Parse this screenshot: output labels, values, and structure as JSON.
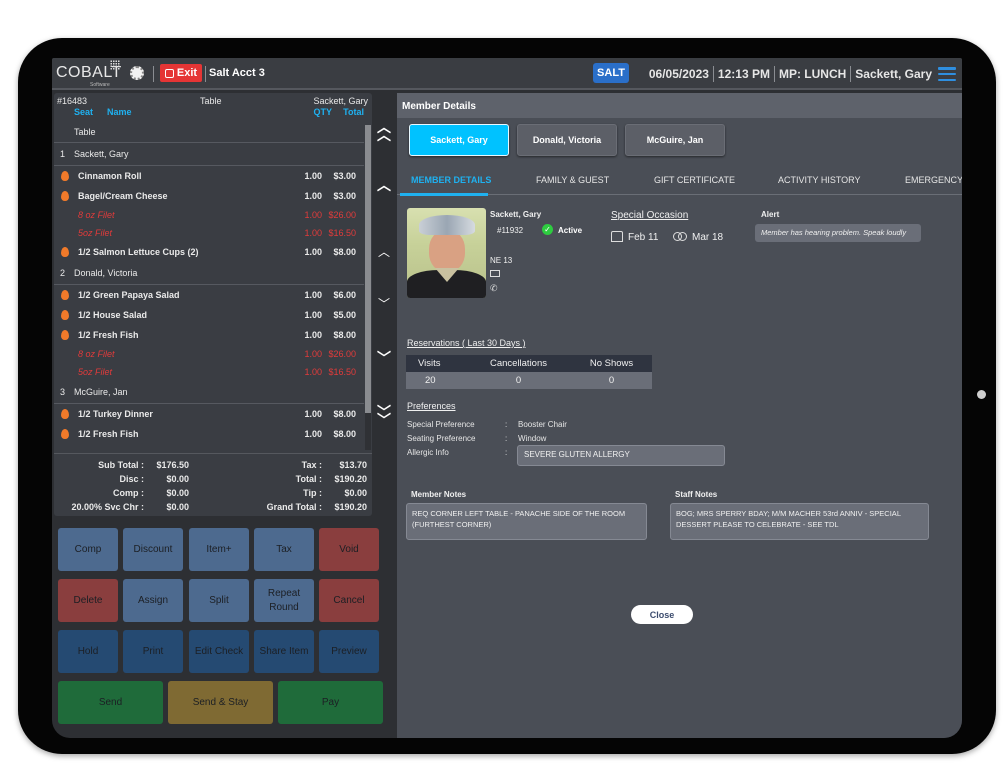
{
  "topbar": {
    "logo": "COBALT",
    "logo_sub": "Software",
    "exit_label": "Exit",
    "account": "Salt Acct 3",
    "location_badge": "SALT",
    "date": "06/05/2023",
    "time": "12:13 PM",
    "meal_period": "MP: LUNCH",
    "user": "Sackett, Gary"
  },
  "order": {
    "check_number": "#16483",
    "table_label": "Table",
    "server": "Sackett, Gary",
    "columns": {
      "seat": "Seat",
      "name": "Name",
      "qty": "QTY",
      "total": "Total"
    },
    "table_row": "Table",
    "seats": [
      {
        "number": "1",
        "name": "Sackett, Gary",
        "items": [
          {
            "name": "Cinnamon Roll",
            "qty": "1.00",
            "total": "$3.00",
            "type": "item"
          },
          {
            "name": "Bagel/Cream Cheese",
            "qty": "1.00",
            "total": "$3.00",
            "type": "item"
          },
          {
            "name": "8 oz Filet",
            "qty": "1.00",
            "total": "$26.00",
            "type": "mod"
          },
          {
            "name": "5oz Filet",
            "qty": "1.00",
            "total": "$16.50",
            "type": "mod"
          },
          {
            "name": "1/2 Salmon Lettuce Cups (2)",
            "qty": "1.00",
            "total": "$8.00",
            "type": "item"
          }
        ]
      },
      {
        "number": "2",
        "name": "Donald, Victoria",
        "items": [
          {
            "name": "1/2 Green Papaya Salad",
            "qty": "1.00",
            "total": "$6.00",
            "type": "item"
          },
          {
            "name": "1/2 House Salad",
            "qty": "1.00",
            "total": "$5.00",
            "type": "item"
          },
          {
            "name": "1/2 Fresh Fish",
            "qty": "1.00",
            "total": "$8.00",
            "type": "item"
          },
          {
            "name": "8 oz Filet",
            "qty": "1.00",
            "total": "$26.00",
            "type": "mod"
          },
          {
            "name": "5oz Filet",
            "qty": "1.00",
            "total": "$16.50",
            "type": "mod"
          }
        ]
      },
      {
        "number": "3",
        "name": "McGuire, Jan",
        "items": [
          {
            "name": "1/2 Turkey Dinner",
            "qty": "1.00",
            "total": "$8.00",
            "type": "item"
          },
          {
            "name": "1/2 Fresh Fish",
            "qty": "1.00",
            "total": "$8.00",
            "type": "item"
          }
        ]
      }
    ],
    "totals": {
      "subtotal_label": "Sub Total :",
      "subtotal": "$176.50",
      "disc_label": "Disc :",
      "disc": "$0.00",
      "comp_label": "Comp :",
      "comp": "$0.00",
      "svc_label": "20.00% Svc Chr :",
      "svc": "$0.00",
      "tax_label": "Tax :",
      "tax": "$13.70",
      "total_label": "Total :",
      "total": "$190.20",
      "tip_label": "Tip :",
      "tip": "$0.00",
      "grand_label": "Grand Total :",
      "grand": "$190.20"
    }
  },
  "actions": {
    "row1": [
      "Comp",
      "Discount",
      "Item+",
      "Tax",
      "Void"
    ],
    "row2": [
      "Delete",
      "Assign",
      "Split",
      "Repeat Round",
      "Cancel"
    ],
    "row3": [
      "Hold",
      "Print",
      "Edit Check",
      "Share Item",
      "Preview"
    ],
    "row4": [
      "Send",
      "Send & Stay",
      "Pay"
    ]
  },
  "member": {
    "title": "Member Details",
    "guests": [
      "Sackett, Gary",
      "Donald, Victoria",
      "McGuire, Jan"
    ],
    "subtabs": [
      "MEMBER DETAILS",
      "FAMILY & GUEST",
      "GIFT CERTIFICATE",
      "ACTIVITY HISTORY",
      "EMERGENCY"
    ],
    "name": "Sackett, Gary",
    "number": "#11932",
    "status": "Active",
    "location": "NE 13",
    "special_occasion_title": "Special Occasion",
    "birthday": "Feb 11",
    "anniversary": "Mar 18",
    "alert_title": "Alert",
    "alert_text": "Member has hearing problem. Speak loudly",
    "reservations_title": "Reservations ( Last 30 Days )",
    "reservations": {
      "headers": [
        "Visits",
        "Cancellations",
        "No Shows"
      ],
      "values": [
        "20",
        "0",
        "0"
      ]
    },
    "preferences_title": "Preferences",
    "preferences": [
      {
        "label": "Special Preference",
        "value": "Booster Chair"
      },
      {
        "label": "Seating Preference",
        "value": "Window"
      },
      {
        "label": "Allergic Info",
        "value": "SEVERE GLUTEN ALLERGY"
      }
    ],
    "member_notes_title": "Member Notes",
    "member_notes": "REQ CORNER LEFT TABLE - PANACHE SIDE OF THE ROOM (FURTHEST CORNER)",
    "staff_notes_title": "Staff Notes",
    "staff_notes": "BOG; MRS SPERRY BDAY; M/M MACHER 53rd ANNIV - SPECIAL DESSERT PLEASE TO CELEBRATE - SEE TDL",
    "close_label": "Close"
  }
}
